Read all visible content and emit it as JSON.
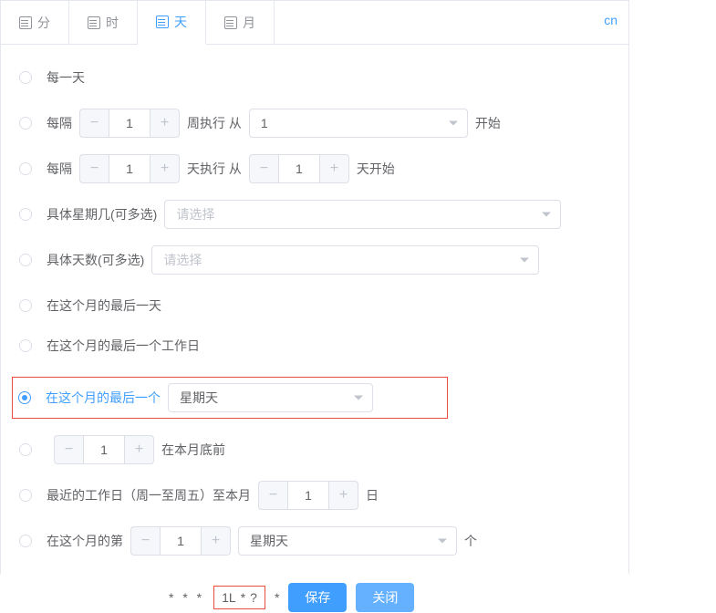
{
  "tabs": {
    "minute": "分",
    "hour": "时",
    "day": "天",
    "month": "月"
  },
  "lang": "cn",
  "options": {
    "every_day": "每一天",
    "every_n_weeks_prefix": "每隔",
    "every_n_weeks_suffix": "周执行 从",
    "every_n_weeks_start": "开始",
    "week_start_value": "1",
    "week_interval_value": "1",
    "every_n_days_prefix": "每隔",
    "every_n_days_suffix": "天执行 从",
    "every_n_days_end": "天开始",
    "day_interval_value": "1",
    "day_from_value": "1",
    "specific_weekday": "具体星期几(可多选)",
    "specific_weekday_placeholder": "请选择",
    "specific_day": "具体天数(可多选)",
    "specific_day_placeholder": "请选择",
    "last_day": "在这个月的最后一天",
    "last_workday": "在这个月的最后一个工作日",
    "last_weekday_prefix": "在这个月的最后一个",
    "last_weekday_value": "星期天",
    "before_end_value": "1",
    "before_end_suffix": "在本月底前",
    "nearest_workday_prefix": "最近的工作日（周一至周五）至本月",
    "nearest_workday_value": "1",
    "nearest_workday_suffix": "日",
    "nth_weekday_prefix": "在这个月的第",
    "nth_value": "1",
    "nth_weekday_value": "星期天",
    "nth_suffix": "个"
  },
  "footer": {
    "cron_prefix": "* * *",
    "cron_day": "1L",
    "cron_mid": "*",
    "cron_dow": "?",
    "cron_suffix": "*",
    "save": "保存",
    "close": "关闭"
  }
}
